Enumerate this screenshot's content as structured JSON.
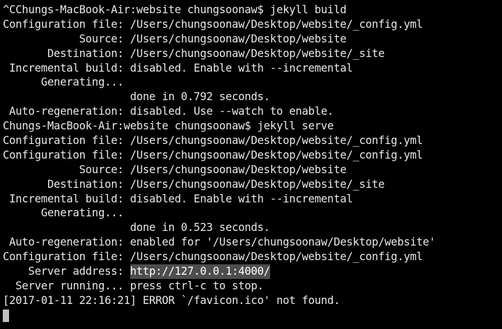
{
  "terminal": {
    "lines": [
      {
        "label": "^CChungs-MacBook-Air:website chungsoonaw$ jekyll build",
        "value": ""
      },
      {
        "label": "Configuration file: ",
        "value": "/Users/chungsoonaw/Desktop/website/_config.yml"
      },
      {
        "label": "            Source: ",
        "value": "/Users/chungsoonaw/Desktop/website"
      },
      {
        "label": "       Destination: ",
        "value": "/Users/chungsoonaw/Desktop/website/_site"
      },
      {
        "label": " Incremental build: ",
        "value": "disabled. Enable with --incremental"
      },
      {
        "label": "      Generating... ",
        "value": ""
      },
      {
        "label": "                    ",
        "value": "done in 0.792 seconds."
      },
      {
        "label": " Auto-regeneration: ",
        "value": "disabled. Use --watch to enable."
      },
      {
        "label": "Chungs-MacBook-Air:website chungsoonaw$ jekyll serve",
        "value": ""
      },
      {
        "label": "Configuration file: ",
        "value": "/Users/chungsoonaw/Desktop/website/_config.yml"
      },
      {
        "label": "Configuration file: ",
        "value": "/Users/chungsoonaw/Desktop/website/_config.yml"
      },
      {
        "label": "            Source: ",
        "value": "/Users/chungsoonaw/Desktop/website"
      },
      {
        "label": "       Destination: ",
        "value": "/Users/chungsoonaw/Desktop/website/_site"
      },
      {
        "label": " Incremental build: ",
        "value": "disabled. Enable with --incremental"
      },
      {
        "label": "      Generating... ",
        "value": ""
      },
      {
        "label": "                    ",
        "value": "done in 0.523 seconds."
      },
      {
        "label": " Auto-regeneration: ",
        "value": "enabled for '/Users/chungsoonaw/Desktop/website'"
      },
      {
        "label": "Configuration file: ",
        "value": "/Users/chungsoonaw/Desktop/website/_config.yml"
      },
      {
        "label": "    Server address: ",
        "value": "http://127.0.0.1:4000/"
      },
      {
        "label": "  Server running... ",
        "value": "press ctrl-c to stop."
      },
      {
        "label": "[2017-01-11 22:16:21] ERROR `/favicon.ico' not found.",
        "value": ""
      }
    ]
  }
}
